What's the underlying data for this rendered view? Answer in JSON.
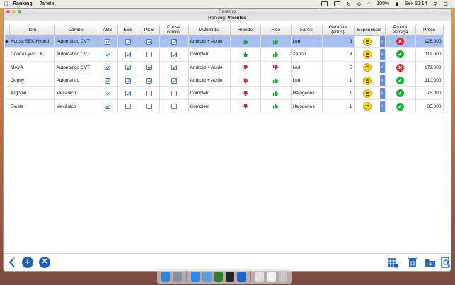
{
  "menubar": {
    "apple": "",
    "app_name": "Ranking",
    "menu_items": [
      "Janela"
    ],
    "battery": "100%",
    "clock": "Sex 12:14"
  },
  "window": {
    "title": "Ranking",
    "subtitle_prefix": "Ranking:",
    "subtitle_value": "Veículos"
  },
  "table": {
    "columns": [
      "Item",
      "Câmbio",
      "ABS",
      "EBS",
      "PCS",
      "Cruise control",
      "Multimídia",
      "Híbrido",
      "Flex",
      "Faróis",
      "Garantia (anos)",
      "Experiência",
      "Pronta entrega",
      "Preço"
    ],
    "rows": [
      {
        "item": "Korola SEK Hybrid",
        "cambio": "Automático CVT",
        "abs": true,
        "ebs": true,
        "pcs": true,
        "cruise": true,
        "multimidia": "Android + Apple",
        "hibrido": true,
        "flex": true,
        "farois": "Led",
        "garantia": "3",
        "experiencia": "happy",
        "pronta": false,
        "preco": "128.000",
        "selected": true
      },
      {
        "item": "Conda Lyvic LX",
        "cambio": "Automático CVT",
        "abs": true,
        "ebs": true,
        "pcs": false,
        "cruise": true,
        "multimidia": "Completo",
        "hibrido": true,
        "flex": true,
        "farois": "Xenon",
        "garantia": "3",
        "experiencia": "neutral",
        "pronta": true,
        "preco": "119.000",
        "selected": false
      },
      {
        "item": "MAV4",
        "cambio": "Automático CVT",
        "abs": true,
        "ebs": true,
        "pcs": true,
        "cruise": true,
        "multimidia": "Android + Apple",
        "hibrido": false,
        "flex": false,
        "farois": "Led",
        "garantia": "5",
        "experiencia": "happy",
        "pronta": false,
        "preco": "179.000",
        "selected": false
      },
      {
        "item": "Gophy",
        "cambio": "Automático",
        "abs": true,
        "ebs": true,
        "pcs": true,
        "cruise": true,
        "multimidia": "Android + Apple",
        "hibrido": false,
        "flex": true,
        "farois": "Led",
        "garantia": "1",
        "experiencia": "neutral",
        "pronta": true,
        "preco": "110.000",
        "selected": false
      },
      {
        "item": "Argonio",
        "cambio": "Mecânico",
        "abs": true,
        "ebs": true,
        "pcs": false,
        "cruise": false,
        "multimidia": "Completo",
        "hibrido": false,
        "flex": true,
        "farois": "Halógenos",
        "garantia": "1",
        "experiencia": "neutral",
        "pronta": true,
        "preco": "75.000",
        "selected": false
      },
      {
        "item": "Siesta",
        "cambio": "Mecânico",
        "abs": true,
        "ebs": false,
        "pcs": false,
        "cruise": false,
        "multimidia": "Completo",
        "hibrido": false,
        "flex": true,
        "farois": "Halógenos",
        "garantia": "1",
        "experiencia": "sad",
        "pronta": true,
        "preco": "35.000",
        "selected": false
      }
    ]
  },
  "toolbar": {
    "back_icon": "chevron-left-icon",
    "add_icon": "plus-circle-icon",
    "remove_icon": "x-circle-icon",
    "right_icons": [
      "table-settings-icon",
      "trash-icon",
      "download-folder-icon",
      "search-document-icon"
    ]
  },
  "colors": {
    "selection": "#a9bfef",
    "accent": "#1e5fb4",
    "thumb_up": "#1e9e3a",
    "thumb_down": "#d52a2a",
    "status_yes": "#1faa3e",
    "status_no": "#e0272d"
  }
}
